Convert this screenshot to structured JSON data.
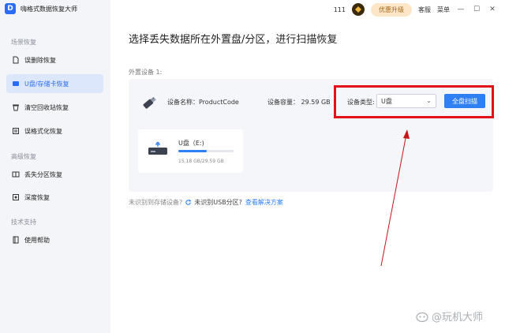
{
  "app": {
    "title": "嗨格式数据恢复大师",
    "logo_letter": "D"
  },
  "topbar": {
    "id_text": "111",
    "upgrade_label": "优惠升级",
    "service_label": "客服",
    "menu_label": "菜单",
    "min_symbol": "—",
    "max_symbol": "☐",
    "close_symbol": "✕"
  },
  "sidebar": {
    "section_scene": "场景恢复",
    "section_advanced": "高级恢复",
    "section_support": "技术支持",
    "items": [
      {
        "label": "误删除恢复",
        "icon": "file-icon"
      },
      {
        "label": "U盘/存储卡恢复",
        "icon": "usb-icon"
      },
      {
        "label": "清空回收站恢复",
        "icon": "trash-icon"
      },
      {
        "label": "误格式化恢复",
        "icon": "format-icon"
      },
      {
        "label": "丢失分区恢复",
        "icon": "partition-icon"
      },
      {
        "label": "深度恢复",
        "icon": "deep-scan-icon"
      },
      {
        "label": "使用帮助",
        "icon": "help-book-icon"
      }
    ]
  },
  "main": {
    "title": "选择丢失数据所在外置盘/分区，进行扫描恢复",
    "group_label": "外置设备 1:",
    "device": {
      "name_text": "设备名称：ProductCode",
      "capacity_text": "设备容量：  29.59 GB",
      "type_label": "设备类型:",
      "type_value": "U盘",
      "scan_label": "全盘扫描"
    },
    "partition": {
      "name": "U盘（E:)",
      "size_text": "15.18 GB/29.59 GB",
      "used_fraction": 0.51
    },
    "help": {
      "question": "未识别到存储设备?",
      "usb_text": "未识别USB分区?",
      "link_text": "查看解决方案"
    }
  },
  "colors": {
    "accent": "#2f80f5",
    "highlight_box": "#e3101a",
    "annotation_arrow": "#c8141b"
  },
  "watermark": {
    "text": "@玩机大师"
  }
}
